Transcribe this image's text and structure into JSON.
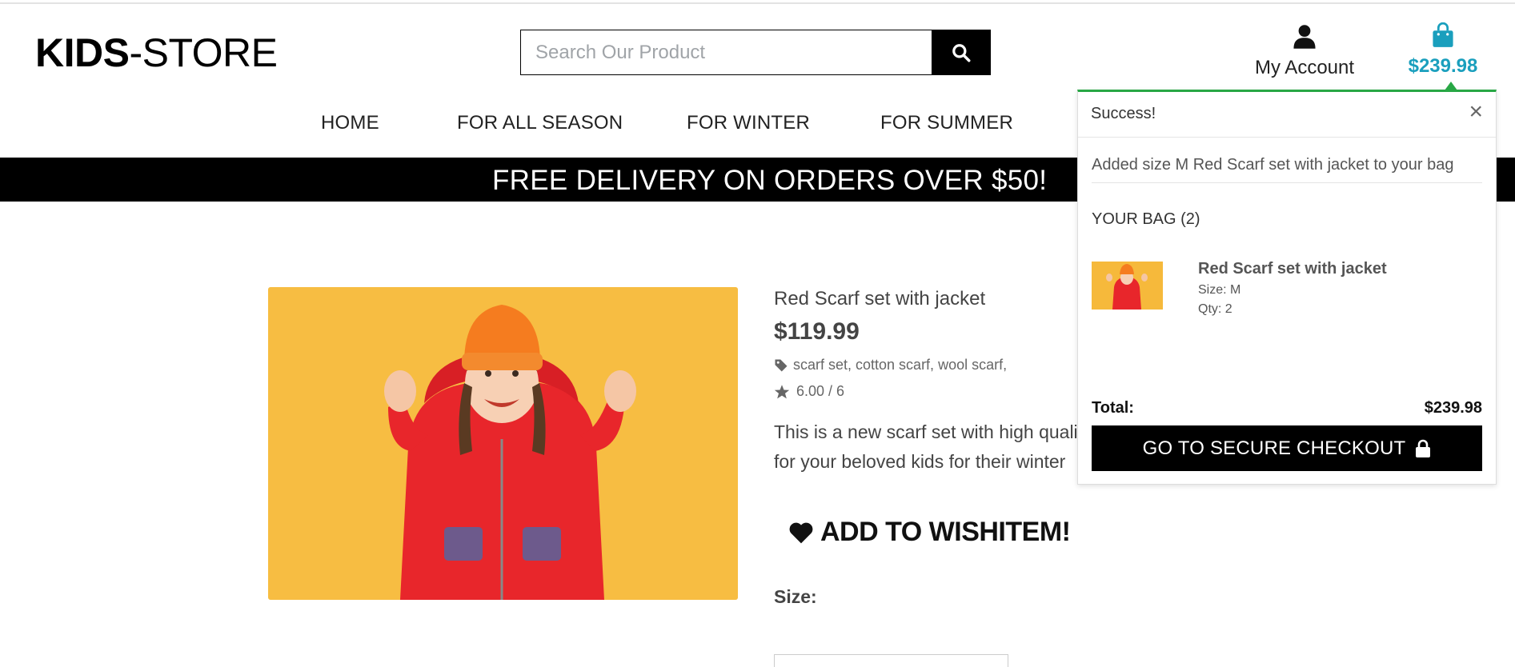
{
  "header": {
    "logo_bold": "KIDS",
    "logo_light": "-STORE",
    "search_placeholder": "Search Our Product",
    "account_label": "My Account",
    "cart_total": "$239.98"
  },
  "nav": {
    "items": [
      "HOME",
      "FOR ALL SEASON",
      "FOR WINTER",
      "FOR SUMMER"
    ]
  },
  "banner": {
    "text": "FREE DELIVERY ON ORDERS OVER $50!"
  },
  "product": {
    "title": "Red Scarf set with jacket",
    "price": "$119.99",
    "tags": "scarf set, cotton scarf, wool scarf,",
    "rating": "6.00 / 6",
    "description_line1": "This is a new scarf set with high quali",
    "description_line2": "for your beloved kids for their winter",
    "wishlist_label": "ADD TO WISHITEM!",
    "size_label": "Size:"
  },
  "toast": {
    "title": "Success!",
    "close": "×",
    "message": "Added size M Red Scarf set with jacket to your bag",
    "bag_heading": "YOUR BAG (2)",
    "item_name": "Red Scarf set with jacket",
    "item_size": "Size: M",
    "item_qty": "Qty: 2",
    "total_label": "Total:",
    "total_value": "$239.98",
    "checkout_label": "GO TO SECURE CHECKOUT"
  },
  "colors": {
    "accent": "#1a9fbd",
    "success": "#28a745",
    "product_bg": "#f6b93b"
  },
  "icons": [
    "search-icon",
    "user-icon",
    "shopping-bag-icon",
    "tag-icon",
    "star-icon",
    "heart-icon",
    "lock-icon",
    "close-icon"
  ]
}
